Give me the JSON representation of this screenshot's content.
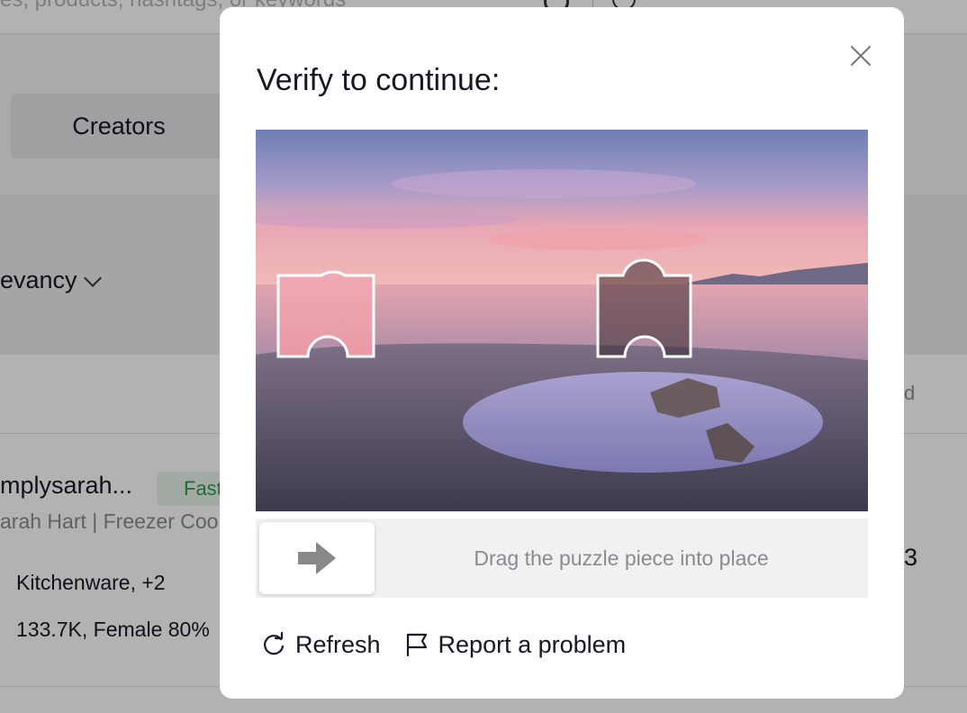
{
  "background": {
    "search_placeholder": "es, products, hashtags, or keywords",
    "creators_tab": "Creators",
    "sort_label": "evancy",
    "header_tail": "d",
    "creator": {
      "name": "mplysarah...",
      "badge": "Fast",
      "subtitle": "arah Hart | Freezer Coo",
      "category": "Kitchenware, +2",
      "audience": "133.7K, Female 80%",
      "trailing_number": "3"
    }
  },
  "modal": {
    "title": "Verify to continue:",
    "slider_hint": "Drag the puzzle piece into place",
    "refresh_label": "Refresh",
    "report_label": "Report a problem",
    "icons": {
      "close": "close-icon",
      "arrow": "arrow-right-icon",
      "refresh": "refresh-icon",
      "flag": "flag-icon"
    }
  }
}
